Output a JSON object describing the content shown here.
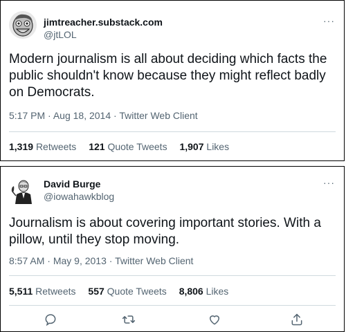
{
  "tweets": [
    {
      "name": "jimtreacher.substack.com",
      "handle": "@jtLOL",
      "text": "Modern journalism is all about deciding which facts the public shouldn't know because they might reflect badly on Democrats.",
      "time": "5:17 PM",
      "date": "Aug 18, 2014",
      "client": "Twitter Web Client",
      "retweets": "1,319",
      "retweets_label": "Retweets",
      "quotes": "121",
      "quotes_label": "Quote Tweets",
      "likes": "1,907",
      "likes_label": "Likes",
      "more": "···"
    },
    {
      "name": "David Burge",
      "handle": "@iowahawkblog",
      "text": "Journalism is about covering important stories. With a pillow, until they stop moving.",
      "time": "8:57 AM",
      "date": "May 9, 2013",
      "client": "Twitter Web Client",
      "retweets": "5,511",
      "retweets_label": "Retweets",
      "quotes": "557",
      "quotes_label": "Quote Tweets",
      "likes": "8,806",
      "likes_label": "Likes",
      "more": "···"
    }
  ],
  "separator": "·",
  "icons": [
    "reply-icon",
    "retweet-icon",
    "like-icon",
    "share-icon"
  ],
  "colors": {
    "text": "#0f1419",
    "secondary": "#536471",
    "divider": "#cfd9de"
  }
}
